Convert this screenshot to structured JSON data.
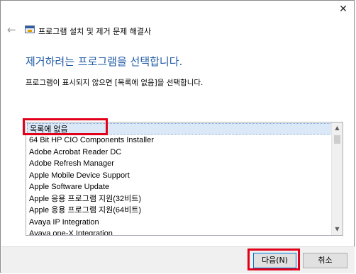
{
  "window": {
    "title": "프로그램 설치 및 제거 문제 해결사",
    "close_glyph": "✕",
    "back_glyph": "←"
  },
  "main": {
    "heading": "제거하려는 프로그램을 선택합니다.",
    "instruction": "프로그램이 표시되지 않으면 [목록에 없음]을 선택합니다.",
    "programs": [
      "목록에 없음",
      "64 Bit HP CIO Components Installer",
      "Adobe Acrobat Reader DC",
      "Adobe Refresh Manager",
      "Apple Mobile Device Support",
      "Apple Software Update",
      "Apple 응용 프로그램 지원(32비트)",
      "Apple 응용 프로그램 지원(64비트)",
      "Avaya IP Integration",
      "Avaya one-X Integration"
    ],
    "selected_index": 0
  },
  "footer": {
    "next_label": "다음(N)",
    "cancel_label": "취소"
  },
  "colors": {
    "heading": "#1f5aa6",
    "highlight": "#e0001a",
    "selection": "#dbe8f7"
  },
  "icons": {
    "back": "back-arrow-icon",
    "app": "troubleshooter-app-icon",
    "close": "close-icon",
    "scroll_up": "scroll-up-arrow-icon",
    "scroll_down": "scroll-down-arrow-icon"
  }
}
